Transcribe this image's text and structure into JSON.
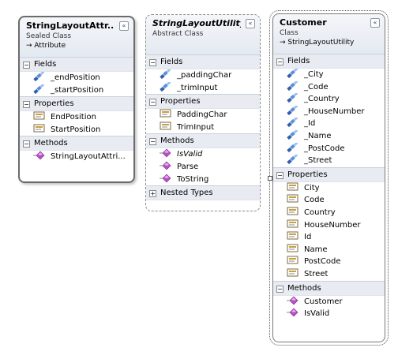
{
  "classes": {
    "attr": {
      "title": "StringLayoutAttr...",
      "kind": "Sealed Class",
      "base": "Attribute",
      "fields_label": "Fields",
      "fields": [
        "_endPosition",
        "_startPosition"
      ],
      "properties_label": "Properties",
      "properties": [
        "EndPosition",
        "StartPosition"
      ],
      "methods_label": "Methods",
      "methods": [
        "StringLayoutAttri..."
      ]
    },
    "util": {
      "title": "StringLayoutUtility",
      "kind": "Abstract Class",
      "fields_label": "Fields",
      "fields": [
        "_paddingChar",
        "_trimInput"
      ],
      "properties_label": "Properties",
      "properties": [
        "PaddingChar",
        "TrimInput"
      ],
      "methods_label": "Methods",
      "methods": [
        "IsValid",
        "Parse",
        "ToString"
      ],
      "nested_label": "Nested Types"
    },
    "customer": {
      "title": "Customer",
      "kind": "Class",
      "base": "StringLayoutUtility",
      "fields_label": "Fields",
      "fields": [
        "_City",
        "_Code",
        "_Country",
        "_HouseNumber",
        "_Id",
        "_Name",
        "_PostCode",
        "_Street"
      ],
      "properties_label": "Properties",
      "properties": [
        "City",
        "Code",
        "Country",
        "HouseNumber",
        "Id",
        "Name",
        "PostCode",
        "Street"
      ],
      "methods_label": "Methods",
      "methods": [
        "Customer",
        "IsValid"
      ]
    }
  },
  "glyphs": {
    "collapse": "«",
    "minus": "−",
    "plus": "+",
    "arrow": "→"
  },
  "icons": {
    "field": "field-icon",
    "property": "property-icon",
    "method": "method-icon"
  },
  "colors": {
    "method": "#b84fc6",
    "field": "#2f5fb3",
    "property": "#c9a13a"
  }
}
